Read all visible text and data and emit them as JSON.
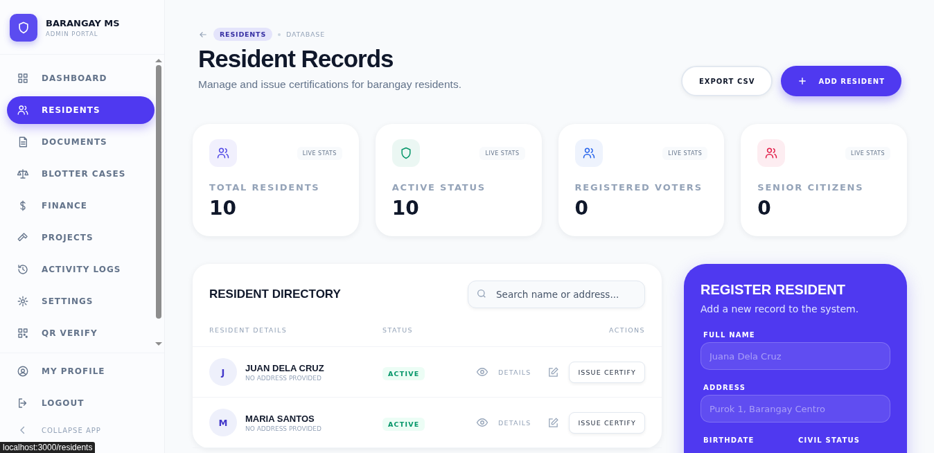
{
  "brand": {
    "name": "BARANGAY MS",
    "subtitle": "ADMIN PORTAL"
  },
  "nav": [
    {
      "label": "DASHBOARD",
      "selected": false
    },
    {
      "label": "RESIDENTS",
      "selected": true
    },
    {
      "label": "DOCUMENTS",
      "selected": false
    },
    {
      "label": "BLOTTER CASES",
      "selected": false
    },
    {
      "label": "FINANCE",
      "selected": false
    },
    {
      "label": "PROJECTS",
      "selected": false
    },
    {
      "label": "ACTIVITY LOGS",
      "selected": false
    },
    {
      "label": "SETTINGS",
      "selected": false
    },
    {
      "label": "QR VERIFY",
      "selected": false
    }
  ],
  "footer_nav": [
    "MY PROFILE",
    "LOGOUT",
    "COLLAPSE APP"
  ],
  "status_url": "localhost:3000/residents",
  "breadcrumb": {
    "current": "RESIDENTS",
    "section": "DATABASE"
  },
  "title": "Resident Records",
  "subtitle": "Manage and issue certifications for barangay residents.",
  "buttons": {
    "export": "EXPORT CSV",
    "add": "ADD RESIDENT"
  },
  "stats": [
    {
      "label": "TOTAL RESIDENTS",
      "value": "10",
      "badge": "LIVE STATS",
      "color": "#4f46e5"
    },
    {
      "label": "ACTIVE STATUS",
      "value": "10",
      "badge": "LIVE STATS",
      "color": "#059669"
    },
    {
      "label": "REGISTERED VOTERS",
      "value": "0",
      "badge": "LIVE STATS",
      "color": "#2563eb"
    },
    {
      "label": "SENIOR CITIZENS",
      "value": "0",
      "badge": "LIVE STATS",
      "color": "#e11d48"
    }
  ],
  "directory": {
    "title": "RESIDENT DIRECTORY",
    "search": {
      "placeholder": "Search name or address..."
    },
    "columns": [
      "RESIDENT DETAILS",
      "STATUS",
      "ACTIONS"
    ],
    "rows": [
      {
        "initial": "J",
        "name": "JUAN DELA CRUZ",
        "address": "NO ADDRESS PROVIDED",
        "status": "ACTIVE",
        "details": "DETAILS",
        "issue": "ISSUE CERTIFY"
      },
      {
        "initial": "M",
        "name": "MARIA SANTOS",
        "address": "NO ADDRESS PROVIDED",
        "status": "ACTIVE",
        "details": "DETAILS",
        "issue": "ISSUE CERTIFY"
      }
    ]
  },
  "register": {
    "title": "REGISTER RESIDENT",
    "subtitle": "Add a new record to the system.",
    "fields": [
      {
        "label": "FULL NAME",
        "placeholder": "Juana Dela Cruz"
      },
      {
        "label": "ADDRESS",
        "placeholder": "Purok 1, Barangay Centro"
      }
    ],
    "next_labels": [
      "BIRTHDATE",
      "CIVIL STATUS"
    ]
  }
}
